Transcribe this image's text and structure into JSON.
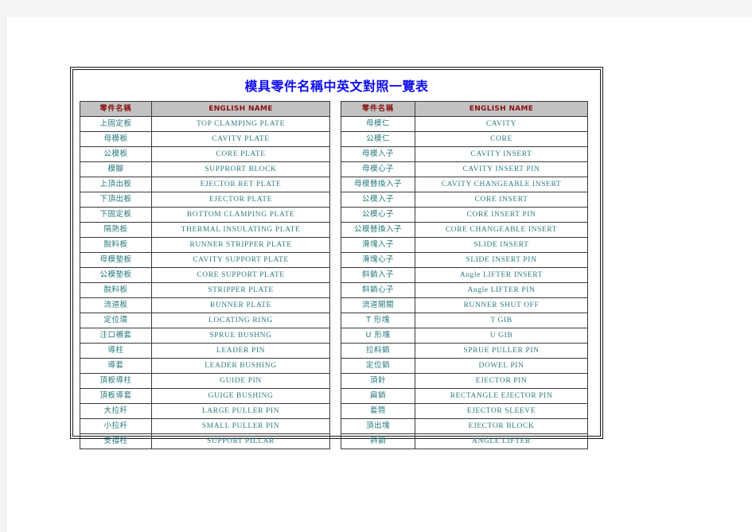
{
  "document": {
    "title": "模具零件名稱中英文對照一覽表",
    "title_color": "#0d0df0",
    "header_bg": "#c2c2c2",
    "header_text_color": "#8a1010",
    "body_text_color": "#2e7a7e"
  },
  "tables": [
    {
      "name": "left-table",
      "headers": [
        "零件名稱",
        "ENGLISH NAME"
      ],
      "rows": [
        [
          "上固定板",
          "TOP CLAMPING PLATE"
        ],
        [
          "母模板",
          "CAVITY PLATE"
        ],
        [
          "公模板",
          "CORE PLATE"
        ],
        [
          "模腳",
          "SUPPRORT BLOCK"
        ],
        [
          "上頂出板",
          "EJECTOR RET PLATE"
        ],
        [
          "下頂出板",
          "EJECTOR PLATE"
        ],
        [
          "下固定板",
          "BOTTOM CLAMPING PLATE"
        ],
        [
          "隔熱板",
          "THERMAL INSULATING PLATE"
        ],
        [
          "脫料板",
          "RUNNER STRIPPER PLATE"
        ],
        [
          "母模墊板",
          "CAVITY SUPPORT PLATE"
        ],
        [
          "公模墊板",
          "CORE SUPPORT PLATE"
        ],
        [
          "脫料板",
          "STRIPPER PLATE"
        ],
        [
          "流道板",
          "RUNNER PLATE"
        ],
        [
          "定位環",
          "LOCATING RING"
        ],
        [
          "注口襯套",
          "SPRUE BUSHNG"
        ],
        [
          "導柱",
          "LEADER PIN"
        ],
        [
          "導套",
          "LEADER BUSHING"
        ],
        [
          "頂板導柱",
          "GUIDE PIN"
        ],
        [
          "頂板導套",
          "GUIGE BUSHING"
        ],
        [
          "大拉杆",
          "LARGE PULLER PIN"
        ],
        [
          "小拉杆",
          "SMALL PULLER PIN"
        ],
        [
          "支撐柱",
          "SUPPORT PILLAR"
        ]
      ]
    },
    {
      "name": "right-table",
      "headers": [
        "零件名稱",
        "ENGLISH NAME"
      ],
      "rows": [
        [
          "母模仁",
          "CAVITY"
        ],
        [
          "公模仁",
          "CORE"
        ],
        [
          "母模入子",
          "CAVITY INSERT"
        ],
        [
          "母模心子",
          "CAVITY   INSERT PIN"
        ],
        [
          "母模替換入子",
          "CAVITY CHANGEABLE INSERT"
        ],
        [
          "公模入子",
          "CORE INSERT"
        ],
        [
          "公模心子",
          "CORE INSERT PIN"
        ],
        [
          "公模替換入子",
          "CORE CHANGEABLE INSERT"
        ],
        [
          "滑塊入子",
          "SLIDE INSERT"
        ],
        [
          "滑塊心子",
          "SLIDE INSERT PIN"
        ],
        [
          "斜銷入子",
          "Angle LIFTER INSERT"
        ],
        [
          "斜銷心子",
          "Angle LIFTER PIN"
        ],
        [
          "流道開關",
          "RUNNER SHUT OFF"
        ],
        [
          "T 形塊",
          "T GIB"
        ],
        [
          "U 形塊",
          "U GIB"
        ],
        [
          "拉料銷",
          "SPRUE PULLER PIN"
        ],
        [
          "定位銷",
          "DOWEL PIN"
        ],
        [
          "頂針",
          "EJECTOR PIN"
        ],
        [
          "扁銷",
          "RECTANGLE EJECTOR PIN"
        ],
        [
          "套筒",
          "EJECTOR SLEEVE"
        ],
        [
          "頂出塊",
          "EJECTOR BLOCK"
        ],
        [
          "斜銷",
          "ANGLE LIFTER"
        ]
      ]
    }
  ]
}
